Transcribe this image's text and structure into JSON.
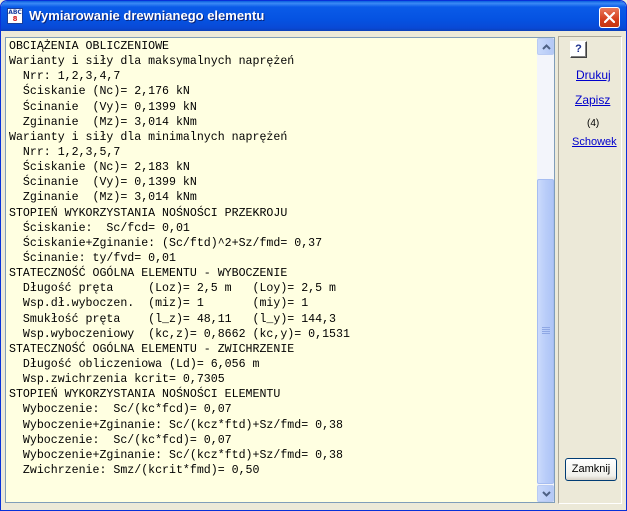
{
  "window": {
    "title": "Wymiarowanie drewnianego elementu",
    "icon": "abc-app-icon",
    "icon_text": [
      "ABC",
      "8"
    ],
    "accent": "#0553e2",
    "close_color": "#d43e1c",
    "content_bg": "#ffffe1"
  },
  "report": {
    "lines": [
      "OBCIĄŻENIA OBLICZENIOWE",
      "Warianty i siły dla maksymalnych naprężeń",
      "  Nrr: 1,2,3,4,7",
      "  Ściskanie (Nc)= 2,176 kN",
      "  Ścinanie  (Vy)= 0,1399 kN",
      "  Zginanie  (Mz)= 3,014 kNm",
      "Warianty i siły dla minimalnych naprężeń",
      "  Nrr: 1,2,3,5,7",
      "  Ściskanie (Nc)= 2,183 kN",
      "  Ścinanie  (Vy)= 0,1399 kN",
      "  Zginanie  (Mz)= 3,014 kNm",
      "STOPIEŃ WYKORZYSTANIA NOŚNOŚCI PRZEKROJU",
      "  Ściskanie:  Sc/fcd= 0,01",
      "  Ściskanie+Zginanie: (Sc/ftd)^2+Sz/fmd= 0,37",
      "  Ścinanie: ty/fvd= 0,01",
      "STATECZNOŚĆ OGÓLNA ELEMENTU - WYBOCZENIE",
      "  Długość pręta     (Loz)= 2,5 m   (Loy)= 2,5 m",
      "  Wsp.dł.wyboczen.  (miz)= 1       (miy)= 1",
      "  Smukłość pręta    (l_z)= 48,11   (l_y)= 144,3",
      "  Wsp.wyboczeniowy  (kc,z)= 0,8662 (kc,y)= 0,1531",
      "STATECZNOŚĆ OGÓLNA ELEMENTU - ZWICHRZENIE",
      "  Długość obliczeniowa (Ld)= 6,056 m",
      "  Wsp.zwichrzenia kcrit= 0,7305",
      "STOPIEŃ WYKORZYSTANIA NOŚNOŚCI ELEMENTU",
      "  Wyboczenie:  Sc/(kc*fcd)= 0,07",
      "  Wyboczenie+Zginanie: Sc/(kcz*ftd)+Sz/fmd= 0,38",
      "  Wyboczenie:  Sc/(kc*fcd)= 0,07",
      "  Wyboczenie+Zginanie: Sc/(kcz*ftd)+Sz/fmd= 0,38",
      "  Zwichrzenie: Smz/(kcrit*fmd)= 0,50"
    ],
    "scroll_position": 0.97
  },
  "side": {
    "help_label": "?",
    "print_label": "Drukuj",
    "save_label": "Zapisz",
    "count_label": "(4)",
    "clipboard_label": "Schowek",
    "close_label": "Zamknij"
  }
}
